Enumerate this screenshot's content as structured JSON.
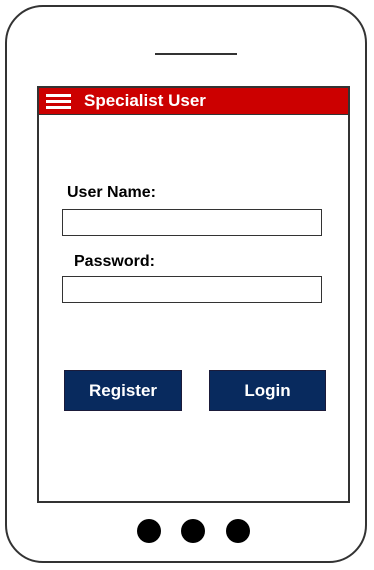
{
  "header": {
    "menu_icon": "hamburger-menu-icon",
    "title": "Specialist User",
    "background_color": "#cc0000"
  },
  "form": {
    "username_label": "User Name:",
    "username_value": "",
    "password_label": "Password:",
    "password_value": ""
  },
  "buttons": {
    "register_label": "Register",
    "login_label": "Login",
    "color": "#082a5e"
  },
  "device": {
    "nav_dots": [
      "dot-1",
      "dot-2",
      "dot-3"
    ]
  }
}
